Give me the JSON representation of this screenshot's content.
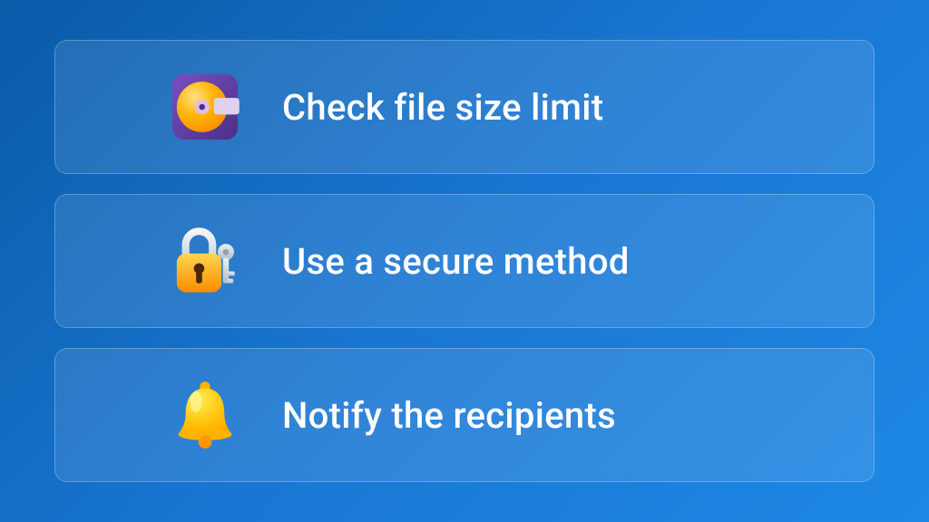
{
  "cards": [
    {
      "label": "Check file size limit",
      "icon": "disc-icon"
    },
    {
      "label": "Use a secure method",
      "icon": "lock-key-icon"
    },
    {
      "label": "Notify the recipients",
      "icon": "bell-icon"
    }
  ]
}
